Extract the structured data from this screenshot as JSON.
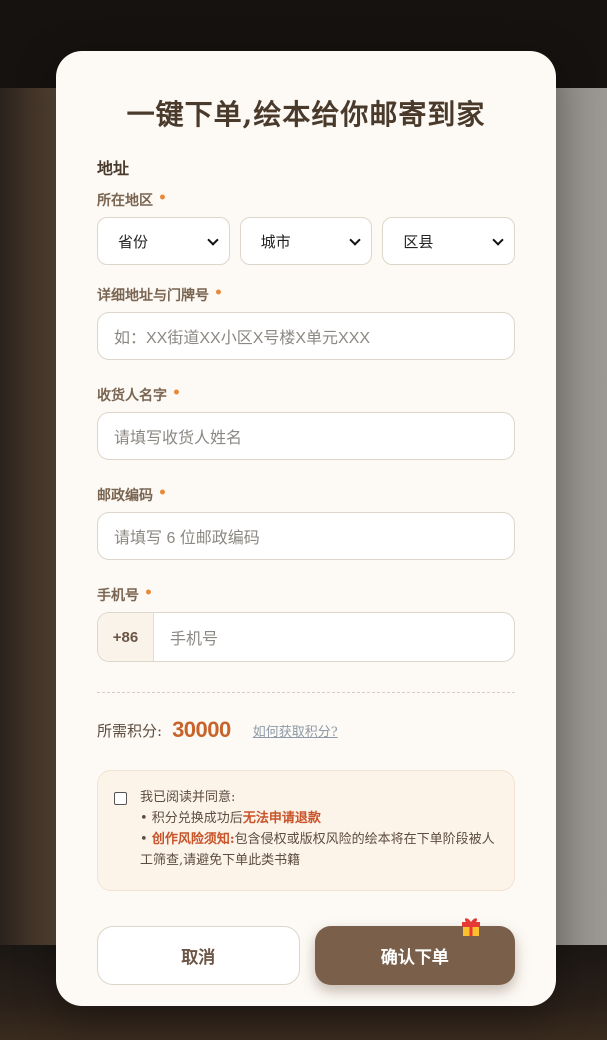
{
  "modal": {
    "title": "一键下单,绘本给你邮寄到家",
    "section_address": "地址",
    "region": {
      "label": "所在地区",
      "required_mark": "•",
      "province": "省份",
      "city": "城市",
      "district": "区县"
    },
    "detail_address": {
      "label": "详细地址与门牌号",
      "required_mark": "•",
      "placeholder": "如：XX街道XX小区X号楼X单元XXX"
    },
    "receiver": {
      "label": "收货人名字",
      "required_mark": "•",
      "placeholder": "请填写收货人姓名"
    },
    "postal": {
      "label": "邮政编码",
      "required_mark": "•",
      "placeholder": "请填写 6 位邮政编码"
    },
    "phone": {
      "label": "手机号",
      "required_mark": "•",
      "country_code": "+86",
      "placeholder": "手机号"
    },
    "points": {
      "label": "所需积分:",
      "value": "30000",
      "link": "如何获取积分?"
    },
    "agreement": {
      "intro": "我已阅读并同意:",
      "item1_prefix": "• 积分兑换成功后",
      "item1_highlight": "无法申请退款",
      "item2_bullet": "• ",
      "item2_highlight": "创作风险须知:",
      "item2_text": "包含侵权或版权风险的绘本将在下单阶段被人工筛查,请避免下单此类书籍",
      "checked": false
    },
    "buttons": {
      "cancel": "取消",
      "confirm": "确认下单"
    }
  },
  "colors": {
    "accent": "#7a5f4a",
    "highlight": "#c8542a",
    "required": "#e8893a",
    "points": "#c8642a"
  },
  "icons": {
    "gift": "gift-icon",
    "select_arrow": "chevron-down-icon"
  }
}
